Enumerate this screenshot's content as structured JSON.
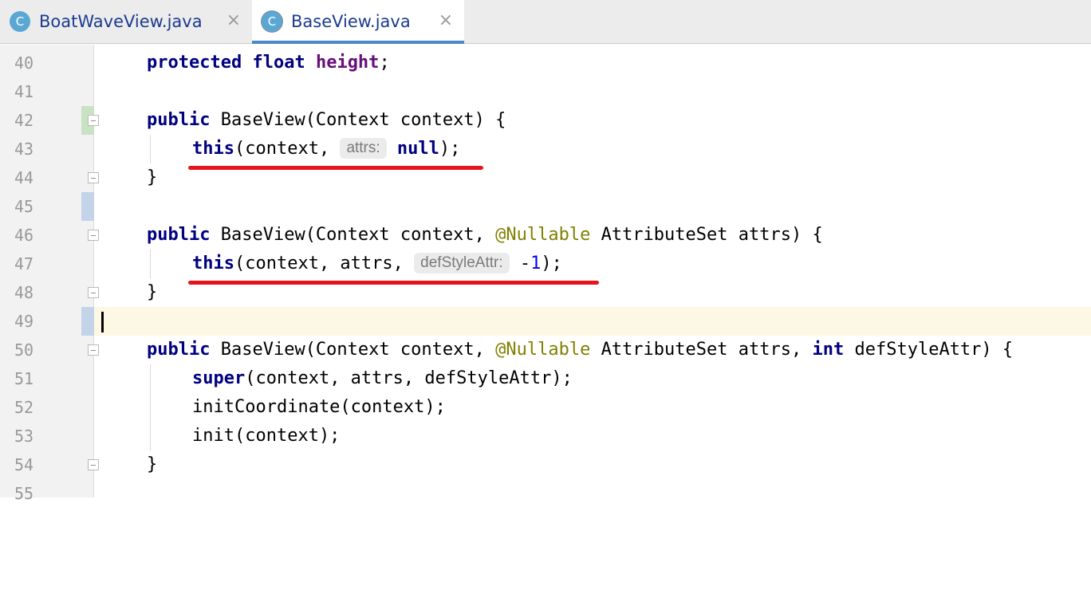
{
  "tabs": [
    {
      "icon": "C",
      "label": "BoatWaveView.java",
      "close": "×",
      "active": false
    },
    {
      "icon": "C",
      "label": "BaseView.java",
      "close": "×",
      "active": true
    }
  ],
  "editor": {
    "current_line": 49,
    "lines": [
      {
        "n": "40"
      },
      {
        "n": "41"
      },
      {
        "n": "42"
      },
      {
        "n": "43"
      },
      {
        "n": "44"
      },
      {
        "n": "45"
      },
      {
        "n": "46"
      },
      {
        "n": "47"
      },
      {
        "n": "48"
      },
      {
        "n": "49"
      },
      {
        "n": "50"
      },
      {
        "n": "51"
      },
      {
        "n": "52"
      },
      {
        "n": "53"
      },
      {
        "n": "54"
      },
      {
        "n": "55"
      }
    ],
    "tokens": {
      "protected": "protected",
      "float": "float",
      "height": "height",
      "semicolon": ";",
      "public": "public",
      "ctor1": " BaseView(Context context) {",
      "this": "this",
      "ctx_comma": "(context, ",
      "hint_attrs": "attrs:",
      "null": "null",
      "close_paren_semi": ");",
      "close_brace": "}",
      "ctor2_a": " BaseView(Context context, ",
      "nullable": "@Nullable",
      "ctor2_b": " AttributeSet attrs) {",
      "ctx_attrs_comma": "(context, attrs, ",
      "hint_defstyle": "defStyleAttr:",
      "minus": "-",
      "one": "1",
      "ctor3_a": " BaseView(Context context, ",
      "ctor3_b": " AttributeSet attrs, ",
      "int": "int",
      "ctor3_c": " defStyleAttr) {",
      "super": "super",
      "super_args": "(context, attrs, defStyleAttr);",
      "init_coord": "initCoordinate(context);",
      "init": "init(context);"
    }
  },
  "colors": {
    "keyword": "#000080",
    "field": "#660e7a",
    "annotation": "#808000",
    "number": "#0000ff",
    "underline": "#e5141a",
    "current_line_bg": "#fcf8e3"
  }
}
